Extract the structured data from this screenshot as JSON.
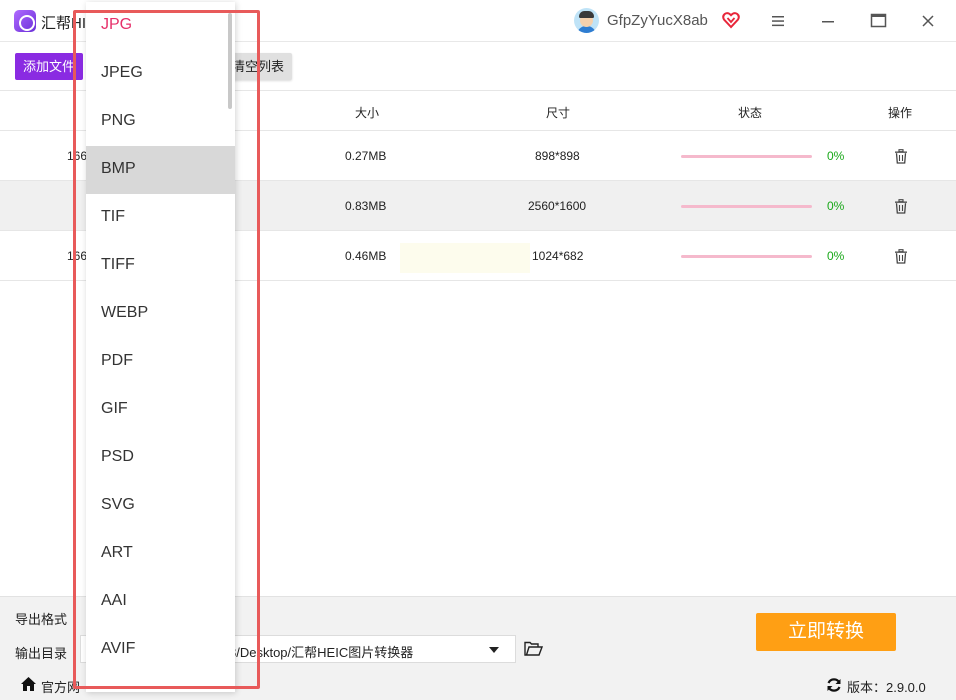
{
  "titlebar": {
    "app_title": "汇帮HI",
    "username": "GfpZyYucX8ab",
    "icons": [
      "app-logo-icon",
      "avatar-icon",
      "vip-heart-icon",
      "menu-icon",
      "minimize-icon",
      "maximize-icon",
      "close-icon"
    ]
  },
  "toolbar": {
    "add_label": "添加文件",
    "clear_label": "清空列表"
  },
  "table": {
    "headers": {
      "size": "大小",
      "dimensions": "尺寸",
      "status": "状态",
      "action": "操作"
    },
    "rows": [
      {
        "name_partial": "166",
        "size": "0.27MB",
        "dimensions": "898*898",
        "progress": 0,
        "percent": "0%"
      },
      {
        "name_partial": "",
        "size": "0.83MB",
        "dimensions": "2560*1600",
        "progress": 0,
        "percent": "0%"
      },
      {
        "name_partial": "166",
        "size": "0.46MB",
        "dimensions": "1024*682",
        "progress": 0,
        "percent": "0%"
      }
    ]
  },
  "bottom": {
    "format_label": "导出格式",
    "dir_label": "输出目录",
    "dir_value": "8/Desktop/汇帮HEIC图片转换器",
    "convert_label": "立即转换",
    "official_label": "官方网",
    "version_label": "版本：2.9.0.0"
  },
  "format_dropdown": {
    "selected": "JPG",
    "hovered": "BMP",
    "options": [
      "JPG",
      "JPEG",
      "PNG",
      "BMP",
      "TIF",
      "TIFF",
      "WEBP",
      "PDF",
      "GIF",
      "PSD",
      "SVG",
      "ART",
      "AAI",
      "AVIF"
    ]
  },
  "colors": {
    "accent_purple": "#8a2be2",
    "convert_orange": "#ff9f14",
    "selected_option": "#e6306a",
    "progress_track": "#f5b9cc",
    "percent_green": "#18a818",
    "annotation_red": "#e85a5a"
  }
}
